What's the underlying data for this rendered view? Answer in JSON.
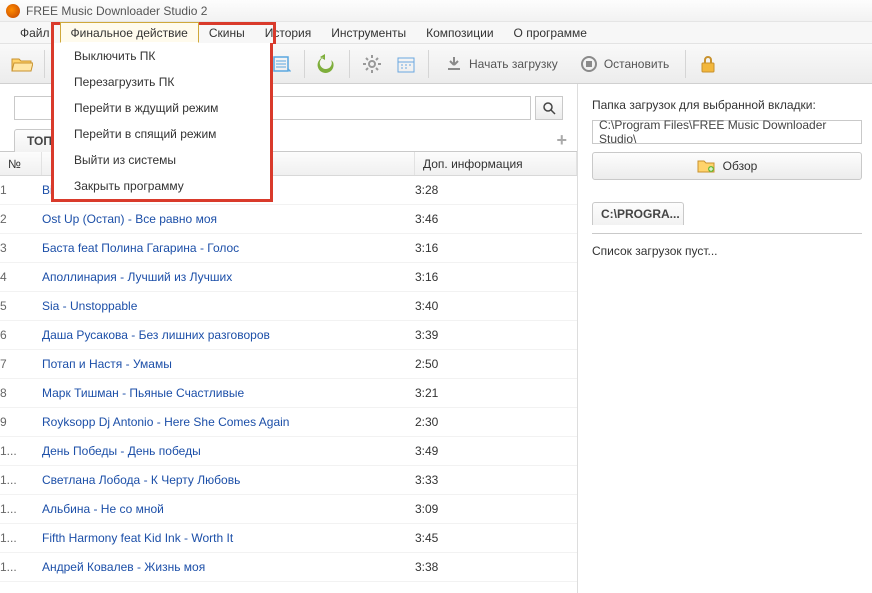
{
  "app": {
    "title": "FREE Music Downloader Studio 2"
  },
  "menubar": {
    "items": [
      "Файл",
      "Финальное действие",
      "Скины",
      "История",
      "Инструменты",
      "Композиции",
      "О программе"
    ],
    "open_index": 1
  },
  "dropdown": {
    "items": [
      "Выключить ПК",
      "Перезагрузить ПК",
      "Перейти в ждущий режим",
      "Перейти в спящий режим",
      "Выйти из системы",
      "Закрыть программу"
    ]
  },
  "toolbar": {
    "start_label": "Начать загрузку",
    "stop_label": "Остановить"
  },
  "search": {
    "value": ""
  },
  "left_tab": "ТОП",
  "columns": {
    "num": "№",
    "title": "",
    "info": "Доп. информация"
  },
  "tracks": [
    {
      "n": "1",
      "title": "Birdy - Keeping Your Head Up",
      "info": "3:28"
    },
    {
      "n": "2",
      "title": "Ost Up (Остап) - Все равно моя",
      "info": "3:46"
    },
    {
      "n": "3",
      "title": "Баста feat Полина Гагарина - Голос",
      "info": "3:16"
    },
    {
      "n": "4",
      "title": "Аполлинария - Лучший из Лучших",
      "info": "3:16"
    },
    {
      "n": "5",
      "title": "Sia - Unstoppable",
      "info": "3:40"
    },
    {
      "n": "6",
      "title": "Даша Русакова - Без лишних разговоров",
      "info": "3:39"
    },
    {
      "n": "7",
      "title": "Потап и Настя - Умамы",
      "info": "2:50"
    },
    {
      "n": "8",
      "title": "Марк Тишман - Пьяные Счастливые",
      "info": "3:21"
    },
    {
      "n": "9",
      "title": "Royksopp Dj Antonio - Here She Comes Again",
      "info": "2:30"
    },
    {
      "n": "1...",
      "title": "День Победы - День победы",
      "info": "3:49"
    },
    {
      "n": "1...",
      "title": "Светлана Лобода - К Черту Любовь",
      "info": "3:33"
    },
    {
      "n": "1...",
      "title": "Альбина - Не со мной",
      "info": "3:09"
    },
    {
      "n": "1...",
      "title": "Fifth Harmony feat Kid Ink - Worth It",
      "info": "3:45"
    },
    {
      "n": "1...",
      "title": "Андрей Ковалев - Жизнь моя",
      "info": "3:38"
    }
  ],
  "right": {
    "folder_label": "Папка загрузок для выбранной вкладки:",
    "folder_path": "C:\\Program Files\\FREE Music Downloader Studio\\",
    "browse_label": "Обзор",
    "tab_label": "C:\\PROGRA...",
    "empty_label": "Список загрузок пуст..."
  }
}
